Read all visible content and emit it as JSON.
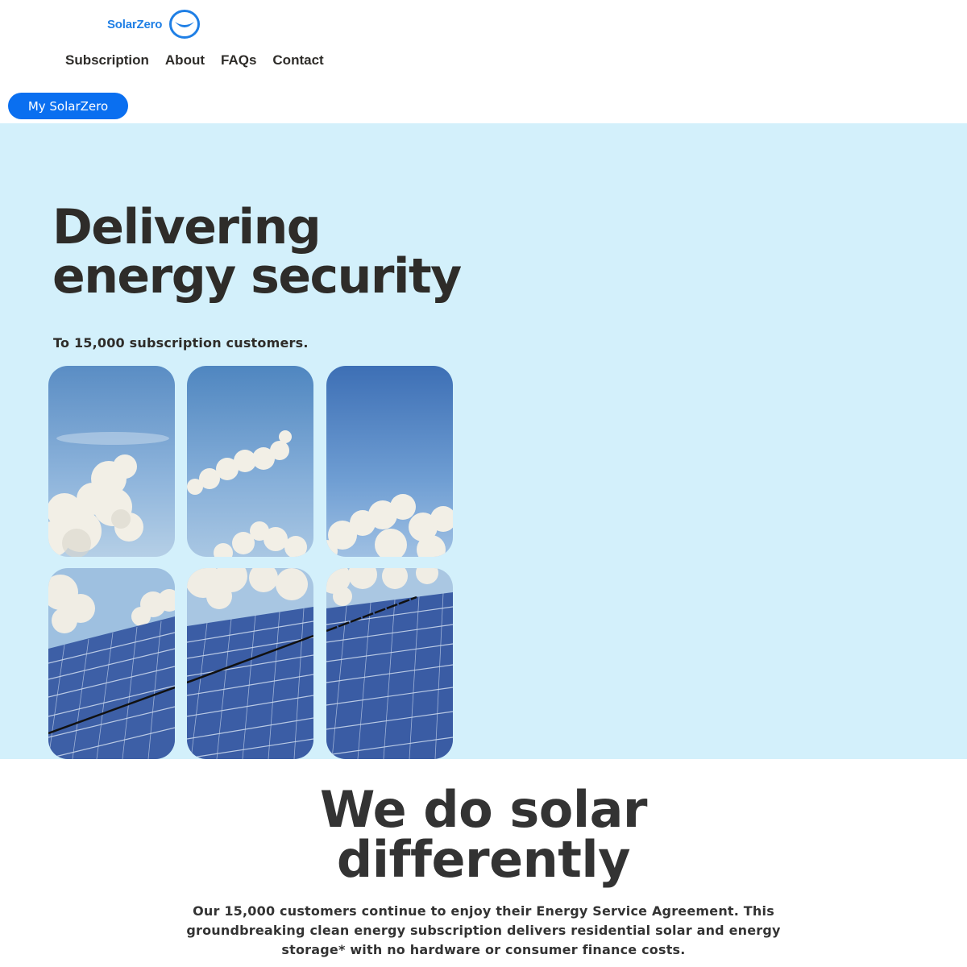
{
  "header": {
    "logo_text": "SolarZero",
    "nav": [
      "Subscription",
      "About",
      "FAQs",
      "Contact"
    ],
    "account_button": "My SolarZero"
  },
  "hero": {
    "title_line1": "Delivering",
    "title_line2": "energy security",
    "subtitle": "To 15,000 subscription customers."
  },
  "section2": {
    "title_line1": "We do solar",
    "title_line2": "differently",
    "body": "Our 15,000 customers continue to enjoy their Energy Service Agreement.  This groundbreaking clean energy subscription delivers residential solar and energy storage* with no hardware or consumer finance costs."
  },
  "colors": {
    "brand_blue": "#1f7fe5",
    "button_blue": "#0a6ff0",
    "hero_bg": "#d3f0fb",
    "text_dark": "#2e2c29"
  },
  "icons": {
    "logo_mark": "smile-circle-icon"
  }
}
